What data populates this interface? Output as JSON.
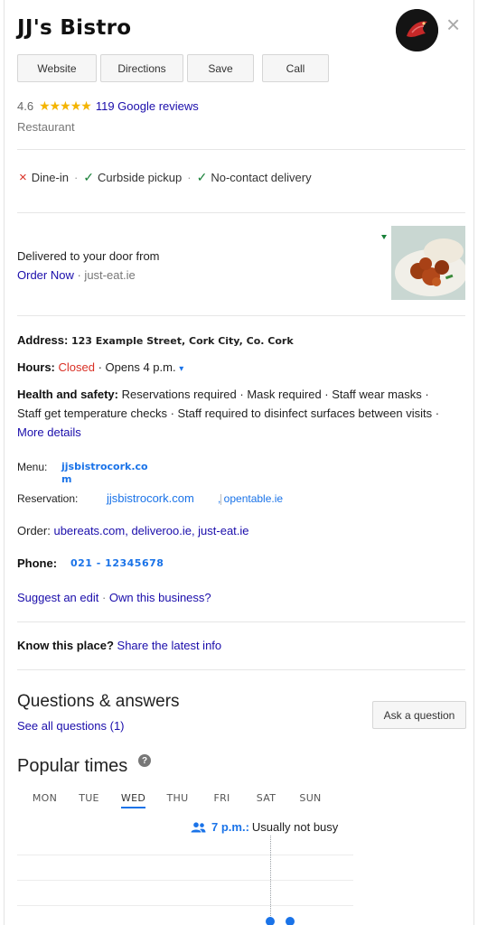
{
  "header": {
    "title": "JJ's Bistro",
    "logo_icon": "restaurant-logo",
    "close_icon": "close-icon"
  },
  "actions": {
    "website": "Website",
    "directions": "Directions",
    "save": "Save",
    "call": "Call"
  },
  "rating": {
    "value": "4.6",
    "stars": "★★★★★",
    "reviews": "119 Google reviews"
  },
  "category": "Restaurant",
  "services": {
    "dine_in": "Dine-in",
    "curbside": "Curbside pickup",
    "no_contact": "No-contact delivery",
    "sep": "·",
    "x_icon": "×",
    "check_icon": "✓"
  },
  "delivery": {
    "text": "Delivered to your door from",
    "link": "Order Now",
    "source": "· just-eat.ie"
  },
  "address": {
    "label": "Address:",
    "value": "123 Example Street, Cork City, Co. Cork"
  },
  "hours": {
    "label": "Hours:",
    "status": "Closed",
    "opens": "· Opens 4 p.m.",
    "caret": "▾"
  },
  "health": {
    "label": "Health and safety:",
    "text": " Reservations required · Mask required · Staff wear masks · Staff get temperature checks · Staff required to disinfect surfaces between visits · ",
    "more": "More details"
  },
  "menu": {
    "label": "Menu:",
    "value": "jjsbistrocork.com"
  },
  "reservation": {
    "label": "Reservation:",
    "value1": "jjsbistrocork.com",
    "value2": ", opentable.ie"
  },
  "order": {
    "label": "Order: ",
    "value": "ubereats.com, deliveroo.ie, just-eat.ie"
  },
  "phone": {
    "label": "Phone:",
    "value": "021 - 12345678"
  },
  "suggest": {
    "edit": "Suggest an edit",
    "sep": " · ",
    "own": "Own this business?"
  },
  "know": {
    "label": "Know this place?",
    "link": " Share the latest info"
  },
  "qa": {
    "title": "Questions & answers",
    "see_all": "See all questions (1)",
    "ask": "Ask a question"
  },
  "popular": {
    "title": "Popular times",
    "help": "?",
    "days": [
      "MON",
      "TUE",
      "WED",
      "THU",
      "FRI",
      "SAT",
      "SUN"
    ],
    "selected_day": "WED",
    "time": "7 p.m.:",
    "status": " Usually not busy"
  },
  "colors": {
    "link": "#1a0dab",
    "accent": "#1a73e8",
    "closed": "#d93025",
    "check": "#188038",
    "star": "#f4b400"
  }
}
